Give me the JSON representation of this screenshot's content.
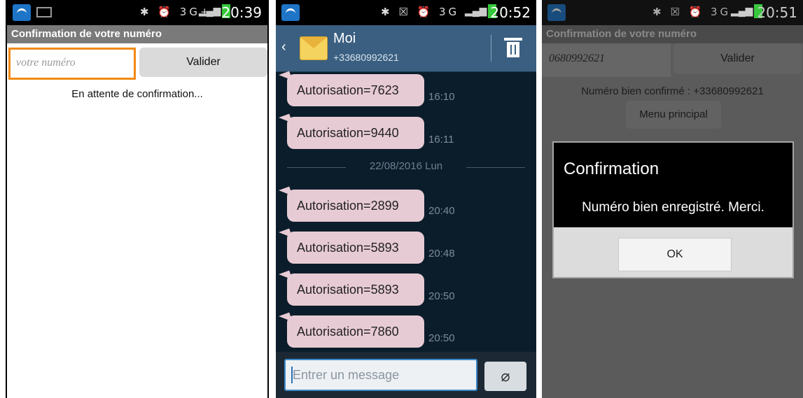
{
  "phone1": {
    "status": {
      "time": "20:39",
      "icons": "✱ ⏰ 3G+"
    },
    "title": "Confirmation de votre numéro",
    "input_placeholder": "votre numéro",
    "validate_label": "Valider",
    "status_message": "En attente de confirmation..."
  },
  "phone2": {
    "status": {
      "time": "20:52",
      "icons": "✱ ☒ ⏰ 3G"
    },
    "contact_name": "Moi",
    "contact_number": "+33680992621",
    "date_separator": "22/08/2016 Lun",
    "messages": [
      {
        "text": "Autorisation=7623",
        "time": "16:10"
      },
      {
        "text": "Autorisation=9440",
        "time": "16:11"
      },
      {
        "text": "Autorisation=2899",
        "time": "20:40"
      },
      {
        "text": "Autorisation=5893",
        "time": "20:48"
      },
      {
        "text": "Autorisation=5893",
        "time": "20:50"
      },
      {
        "text": "Autorisation=7860",
        "time": "20:50"
      }
    ],
    "composer_placeholder": "Entrer un message"
  },
  "phone3": {
    "status": {
      "time": "20:51",
      "icons": "✱ ☒ ⏰ 3G"
    },
    "title": "Confirmation de votre numéro",
    "input_value": "0680992621",
    "validate_label": "Valider",
    "confirmed_text": "Numéro bien confirmé : +33680992621",
    "menu_label": "Menu principal",
    "dialog": {
      "title": "Confirmation",
      "message": "Numéro bien enregistré. Merci.",
      "ok_label": "OK"
    }
  },
  "colors": {
    "accent_orange": "#f08a12",
    "battery_green": "#37c73c",
    "bubble": "#e7cbd4",
    "sms_header": "#3a5f80"
  }
}
